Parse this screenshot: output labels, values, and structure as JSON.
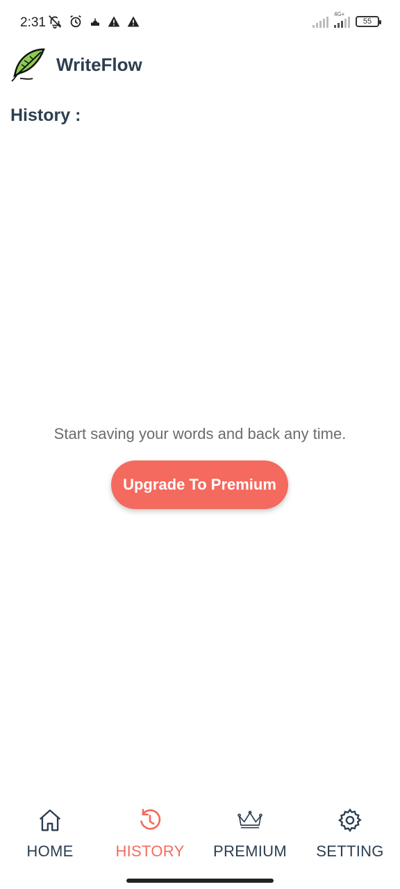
{
  "status_bar": {
    "time": "2:31",
    "network_type": "4G+",
    "battery": "55"
  },
  "header": {
    "app_name": "WriteFlow"
  },
  "page": {
    "title": "History :"
  },
  "empty_state": {
    "message": "Start saving your words and back any time.",
    "button_label": "Upgrade To Premium"
  },
  "nav": {
    "items": [
      {
        "label": "HOME",
        "icon": "home-icon"
      },
      {
        "label": "HISTORY",
        "icon": "history-icon",
        "active": true
      },
      {
        "label": "PREMIUM",
        "icon": "crown-icon"
      },
      {
        "label": "SETTING",
        "icon": "gear-icon"
      }
    ]
  },
  "colors": {
    "accent": "#f56a5e",
    "text_primary": "#2c3e50",
    "text_secondary": "#6b6b6b"
  }
}
